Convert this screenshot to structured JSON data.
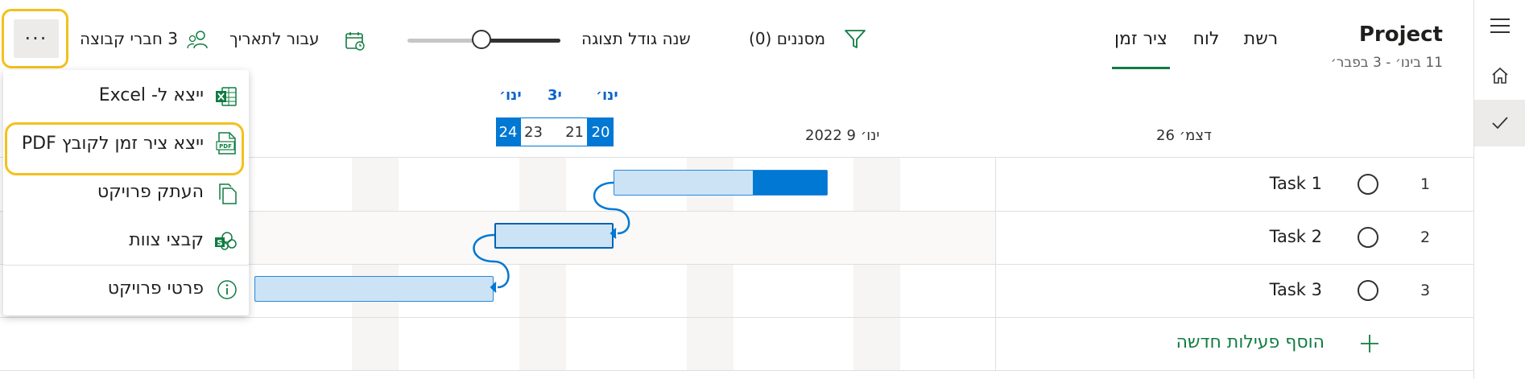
{
  "project": {
    "title": "Project",
    "date_range": "11 בינו׳ - 3 בפבר׳"
  },
  "tabs": [
    {
      "label": "רשת"
    },
    {
      "label": "לוח"
    },
    {
      "label": "ציר זמן",
      "active": true
    }
  ],
  "toolbar": {
    "filters_label": "מסננים (0)",
    "zoom_label": "שנה גודל תצוגה",
    "goto_date_label": "עבור לתאריך",
    "members_label": "3 חברי קבוצה",
    "more_label": "···"
  },
  "menu": {
    "items": [
      {
        "label": "ייצא ל- Excel",
        "icon": "excel-icon"
      },
      {
        "label": "ייצא ציר זמן לקובץ PDF",
        "icon": "pdf-icon"
      },
      {
        "label": "העתק פרויקט",
        "icon": "copy-icon"
      },
      {
        "label": "קבצי צוות",
        "icon": "sharepoint-icon"
      },
      {
        "label": "פרטי פרויקט",
        "icon": "info-icon"
      }
    ]
  },
  "timeline": {
    "month_labels": [
      "ינו׳",
      "3י",
      "ינו׳"
    ],
    "selected_dates": [
      "20",
      "21",
      "23",
      "24"
    ],
    "week_labels": [
      "ינו׳ 9 2022",
      "דצמ׳ 26"
    ]
  },
  "tasks": [
    {
      "num": "1",
      "name": "Task 1",
      "progress": 0.35
    },
    {
      "num": "2",
      "name": "Task 2",
      "progress": 0
    },
    {
      "num": "3",
      "name": "Task 3",
      "progress": 0
    }
  ],
  "add_task_label": "הוסף פעילות חדשה",
  "colors": {
    "accent": "#107c41",
    "bar": "#cce3f5",
    "bar_fill": "#0078d4",
    "highlight": "#f4c01d"
  }
}
